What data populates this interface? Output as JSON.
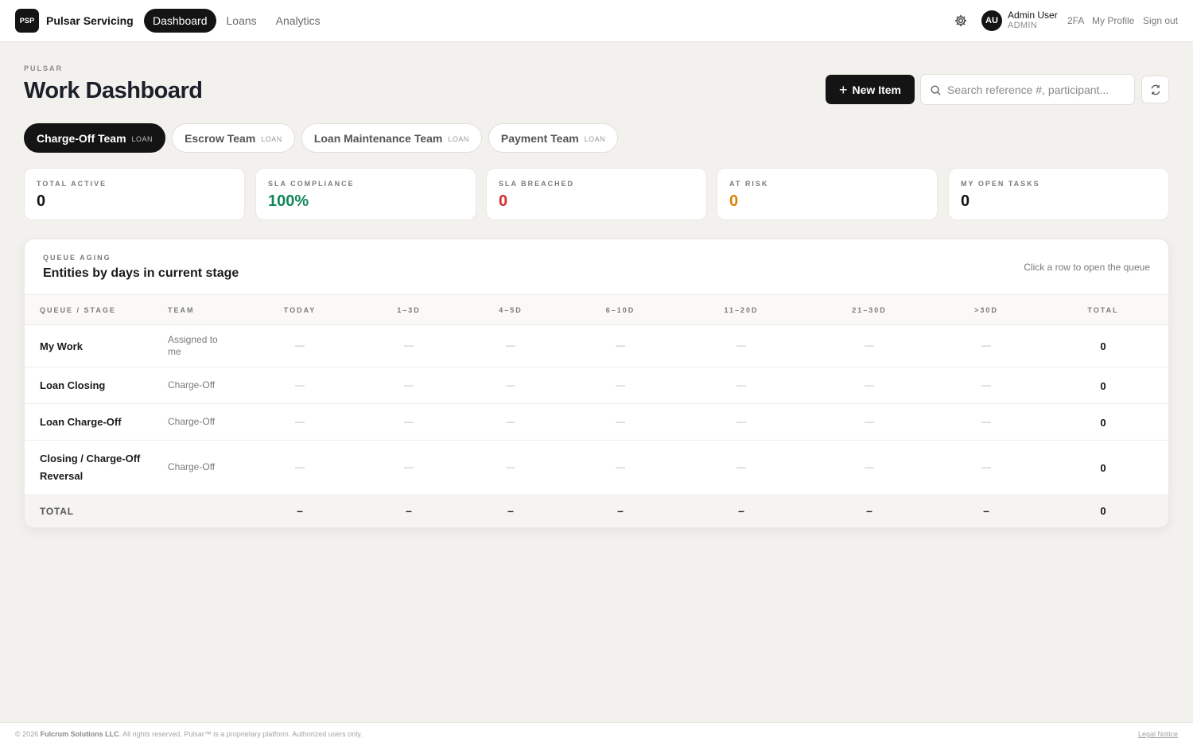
{
  "app": {
    "logo_text": "PSP",
    "brand": "Pulsar Servicing"
  },
  "nav": {
    "items": [
      {
        "label": "Dashboard",
        "active": true
      },
      {
        "label": "Loans",
        "active": false
      },
      {
        "label": "Analytics",
        "active": false
      }
    ]
  },
  "user": {
    "initials": "AU",
    "name": "Admin User",
    "role": "ADMIN",
    "links": [
      "2FA",
      "My Profile",
      "Sign out"
    ]
  },
  "header": {
    "eyebrow": "PULSAR",
    "title": "Work Dashboard",
    "new_item_label": "New Item",
    "search_placeholder": "Search reference #, participant..."
  },
  "team_tabs": [
    {
      "label": "Charge-Off Team",
      "tag": "LOAN",
      "active": true
    },
    {
      "label": "Escrow Team",
      "tag": "LOAN",
      "active": false
    },
    {
      "label": "Loan Maintenance Team",
      "tag": "LOAN",
      "active": false
    },
    {
      "label": "Payment Team",
      "tag": "LOAN",
      "active": false
    }
  ],
  "stats": [
    {
      "label": "TOTAL ACTIVE",
      "value": "0",
      "color": "#141414"
    },
    {
      "label": "SLA COMPLIANCE",
      "value": "100%",
      "color": "#12875a"
    },
    {
      "label": "SLA BREACHED",
      "value": "0",
      "color": "#d62d2d"
    },
    {
      "label": "AT RISK",
      "value": "0",
      "color": "#d9820f"
    },
    {
      "label": "MY OPEN TASKS",
      "value": "0",
      "color": "#141414"
    }
  ],
  "queue": {
    "eyebrow": "QUEUE AGING",
    "title": "Entities by days in current stage",
    "hint": "Click a row to open the queue",
    "columns": [
      "QUEUE / STAGE",
      "TEAM",
      "TODAY",
      "1–3D",
      "4–5D",
      "6–10D",
      "11–20D",
      "21–30D",
      ">30D",
      "TOTAL"
    ],
    "rows": [
      {
        "name": "My Work",
        "team": "Assigned to me",
        "cells": [
          "—",
          "—",
          "—",
          "—",
          "—",
          "—",
          "—"
        ],
        "total": "0"
      },
      {
        "name": "Loan Closing",
        "team": "Charge-Off",
        "cells": [
          "—",
          "—",
          "—",
          "—",
          "—",
          "—",
          "—"
        ],
        "total": "0"
      },
      {
        "name": "Loan Charge-Off",
        "team": "Charge-Off",
        "cells": [
          "—",
          "—",
          "—",
          "—",
          "—",
          "—",
          "—"
        ],
        "total": "0"
      },
      {
        "name": "Closing / Charge-Off Reversal",
        "team": "Charge-Off",
        "cells": [
          "—",
          "—",
          "—",
          "—",
          "—",
          "—",
          "—"
        ],
        "total": "0"
      }
    ],
    "total_row": {
      "label": "TOTAL",
      "cells": [
        "–",
        "–",
        "–",
        "–",
        "–",
        "–",
        "–"
      ],
      "total": "0"
    }
  },
  "footer": {
    "year": "© 2026",
    "company": "Fulcrum Solutions LLC",
    "rest": ". All rights reserved. Pulsar™ is a proprietary platform. Authorized users only.",
    "legal": "Legal Notice"
  }
}
